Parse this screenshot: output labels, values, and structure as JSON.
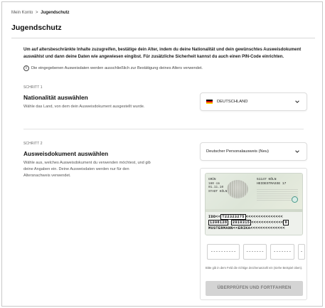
{
  "breadcrumb": {
    "parent": "Mein Konto",
    "separator": ">",
    "current": "Jugendschutz"
  },
  "page": {
    "title": "Jugendschutz",
    "intro": "Um auf altersbeschränkte Inhalte zuzugreifen, bestätige dein Alter, indem du deine Nationalität und dein gewünschtes Ausweisdokument auswählst und dann deine Daten wie angewiesen eingibst. Für zusätzliche Sicherheit kannst du auch einen PIN-Code einrichten.",
    "info": "Die eingegebenen Ausweisdaten werden ausschließlich zur Bestätigung deines Alters verwendet.",
    "info_icon": "info-icon"
  },
  "step1": {
    "label": "SCHRITT 1",
    "heading": "Nationalität auswählen",
    "description": "Wähle das Land, von dem dein Ausweisdokument ausgestellt wurde.",
    "selected_value": "DEUTSCHLAND",
    "flag_colors": [
      "#000000",
      "#dd0000",
      "#ffce00"
    ]
  },
  "step2": {
    "label": "SCHRITT 2",
    "heading": "Ausweisdokument auswählen",
    "description": "Wähle aus, welches Ausweisdokument du verwenden möchtest, und gib deine Angaben ein. Deine Ausweisdaten werden nur für den Altersnachweis verwendet.",
    "selected_value": "Deutscher Personalausweis (Neu)"
  },
  "id_card": {
    "left_lines": [
      "GRÜN",
      "160 cm",
      "01.11.10",
      "STADT KÖLN"
    ],
    "right_lines": [
      "51147 KÖLN",
      "HEIDESTRASSE 17"
    ],
    "mrz_line1_prefix": "IDD<<",
    "mrz_line1_box": "T22323275",
    "mrz_line1_suffix": "<<<<<<<<<<<<<<<",
    "mrz_line2_box1": "1208128",
    "mrz_line2_box2": "2010315",
    "mrz_line2_mid": "<<<<<<<<<<<<<",
    "mrz_line2_box3": "8",
    "mrz_line3": "MUSTERMANN<<ERIKA<<<<<<<<<<<<<<"
  },
  "inputs": {
    "field1": "----------",
    "field2": "-------",
    "field3": "-------",
    "field4": "-"
  },
  "hint": "Bitte gib in dem Feld die richtige Zeichenanzahl ein (siehe Beispiel oben).",
  "submit_label": "ÜBERPRÜFEN UND FORTFAHREN"
}
